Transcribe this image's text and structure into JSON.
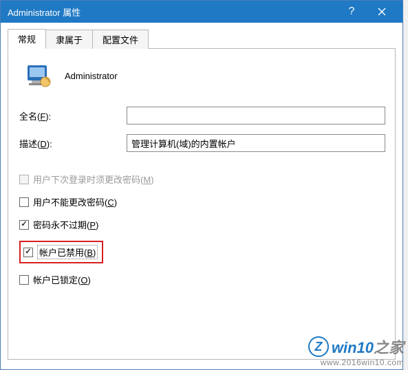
{
  "titlebar": {
    "title": "Administrator 属性",
    "help": "?",
    "close": "×"
  },
  "tabs": {
    "general": "常规",
    "memberof": "隶属于",
    "profile": "配置文件"
  },
  "header": {
    "username": "Administrator"
  },
  "form": {
    "fullname_label": "全名(F):",
    "fullname_value": "",
    "description_label": "描述(D):",
    "description_value": "管理计算机(域)的内置帐户"
  },
  "checks": {
    "must_change": {
      "label": "用户下次登录时须更改密码(M)",
      "checked": false,
      "enabled": false
    },
    "cannot_change": {
      "label": "用户不能更改密码(C)",
      "checked": false,
      "enabled": true
    },
    "never_expires": {
      "label": "密码永不过期(P)",
      "checked": true,
      "enabled": true
    },
    "disabled": {
      "label": "帐户已禁用(B)",
      "checked": true,
      "enabled": true
    },
    "locked": {
      "label": "帐户已锁定(O)",
      "checked": false,
      "enabled": true
    }
  },
  "watermark": {
    "badge": "Z",
    "text_a": "win10",
    "text_b": "之家",
    "url": "www.2016win10.com"
  }
}
